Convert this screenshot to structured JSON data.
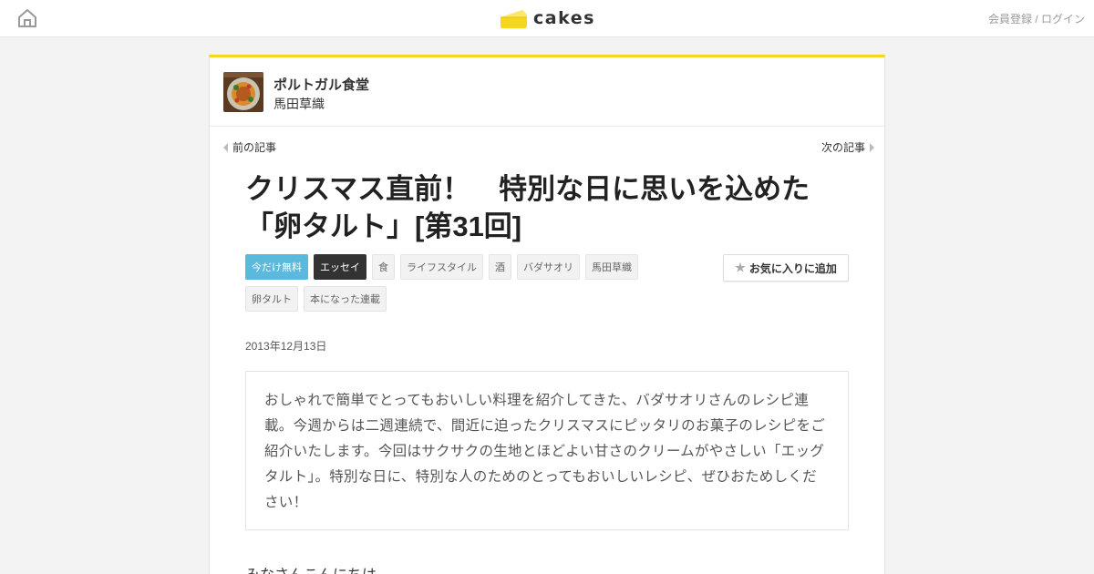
{
  "header": {
    "logo_text": "cakes",
    "login_label": "会員登録 / ログイン",
    "brand_color": "#f7d61f"
  },
  "series": {
    "title": "ポルトガル食堂",
    "author": "馬田草織"
  },
  "nav": {
    "prev_label": "前の記事",
    "next_label": "次の記事"
  },
  "article": {
    "title_line1": "クリスマス直前！　特別な日に思いを込めた",
    "title_line2": "「卵タルト」[第31回]",
    "tags": [
      {
        "label": "今だけ無料",
        "style": "free"
      },
      {
        "label": "エッセイ",
        "style": "essay"
      },
      {
        "label": "食",
        "style": "default"
      },
      {
        "label": "ライフスタイル",
        "style": "default"
      },
      {
        "label": "酒",
        "style": "default"
      },
      {
        "label": "バダサオリ",
        "style": "default"
      },
      {
        "label": "馬田草織",
        "style": "default"
      },
      {
        "label": "卵タルト",
        "style": "default"
      },
      {
        "label": "本になった連載",
        "style": "default"
      }
    ],
    "favorite_label": "お気に入りに追加",
    "date": "2013年12月13日",
    "lead": "おしゃれで簡単でとってもおいしい料理を紹介してきた、バダサオリさんのレシピ連載。今週からは二週連続で、間近に迫ったクリスマスにピッタリのお菓子のレシピをご紹介いたします。今回はサクサクの生地とほどよい甘さのクリームがやさしい「エッグタルト」。特別な日に、特別な人のためのとってもおいしいレシピ、ぜひおためしください！",
    "body_start": "みなさんこんにちは。"
  },
  "icons": {
    "home": "home-icon",
    "star": "star-icon",
    "prev": "triangle-left-icon",
    "next": "triangle-right-icon"
  }
}
